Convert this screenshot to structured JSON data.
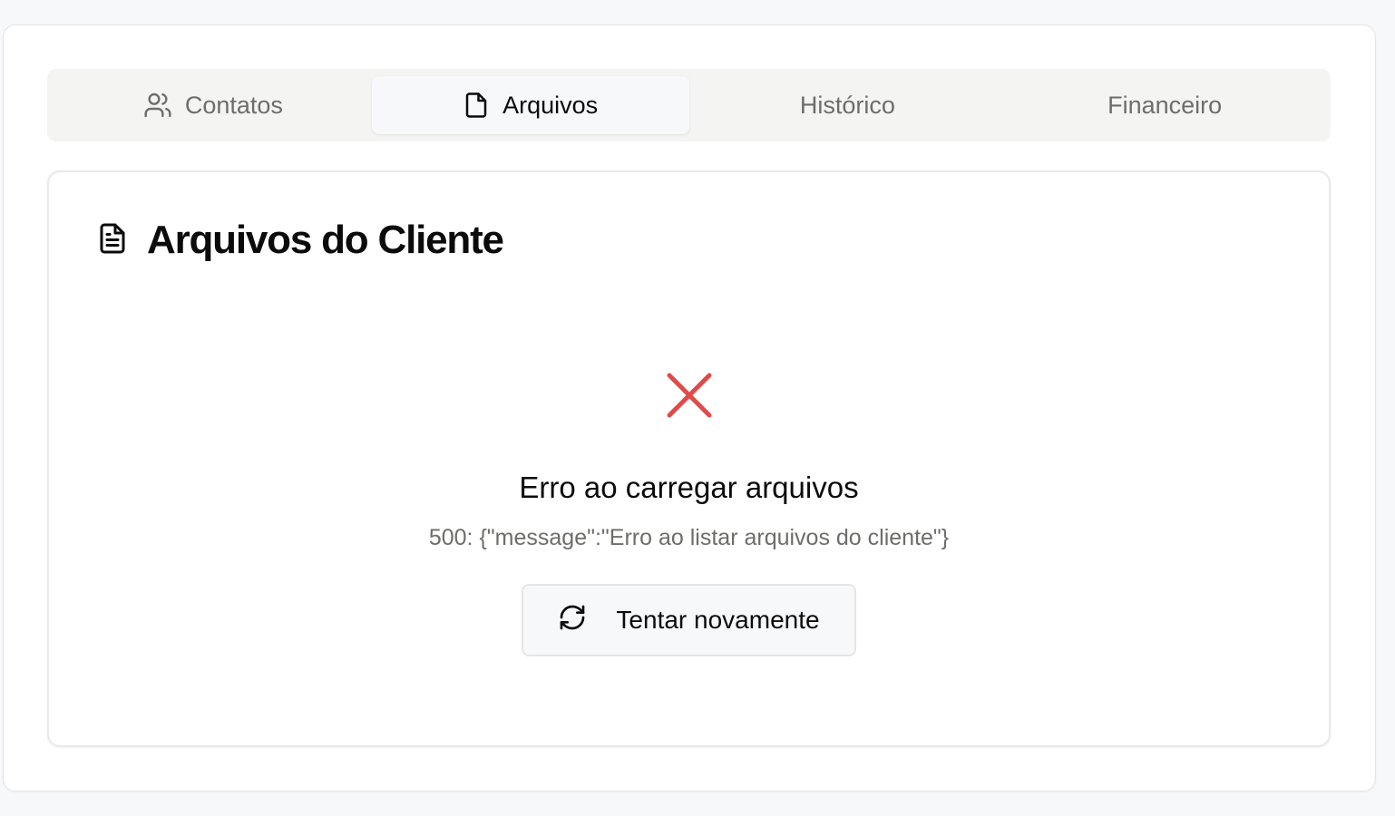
{
  "tabs": [
    {
      "label": "Contatos",
      "icon": "users-icon",
      "active": false
    },
    {
      "label": "Arquivos",
      "icon": "file-icon",
      "active": true
    },
    {
      "label": "Histórico",
      "active": false
    },
    {
      "label": "Financeiro",
      "active": false
    }
  ],
  "card": {
    "title": "Arquivos do Cliente",
    "icon": "file-text-icon"
  },
  "error": {
    "icon": "x-icon",
    "icon_color": "#e04b4a",
    "title": "Erro ao carregar arquivos",
    "message": "500: {\"message\":\"Erro ao listar arquivos do cliente\"}",
    "retry_label": "Tentar novamente",
    "retry_icon": "refresh-icon"
  },
  "colors": {
    "page_bg": "#f7f8fa",
    "tabs_bg": "#f4f4f2",
    "muted_text": "#6d6d6a",
    "error": "#e04b4a"
  }
}
